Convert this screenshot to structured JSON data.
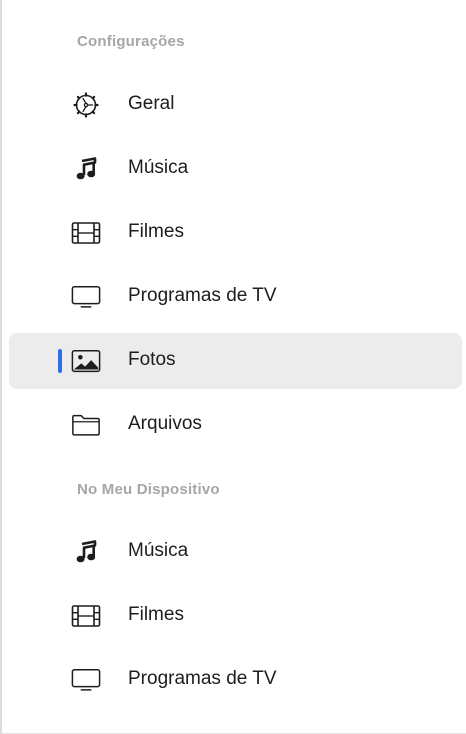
{
  "sections": [
    {
      "header": "Configurações",
      "items": [
        {
          "label": "Geral",
          "icon": "gear-icon"
        },
        {
          "label": "Música",
          "icon": "music-note-icon"
        },
        {
          "label": "Filmes",
          "icon": "film-icon"
        },
        {
          "label": "Programas de TV",
          "icon": "tv-icon"
        },
        {
          "label": "Fotos",
          "icon": "photo-icon",
          "selected": true
        },
        {
          "label": "Arquivos",
          "icon": "folder-icon"
        }
      ]
    },
    {
      "header": "No Meu Dispositivo",
      "items": [
        {
          "label": "Música",
          "icon": "music-note-icon"
        },
        {
          "label": "Filmes",
          "icon": "film-icon"
        },
        {
          "label": "Programas de TV",
          "icon": "tv-icon"
        }
      ]
    }
  ],
  "colors": {
    "accent": "#2f6fe4",
    "selected_background": "#ececec",
    "section_header": "#a6a6a6",
    "text": "#1d1d1f"
  }
}
